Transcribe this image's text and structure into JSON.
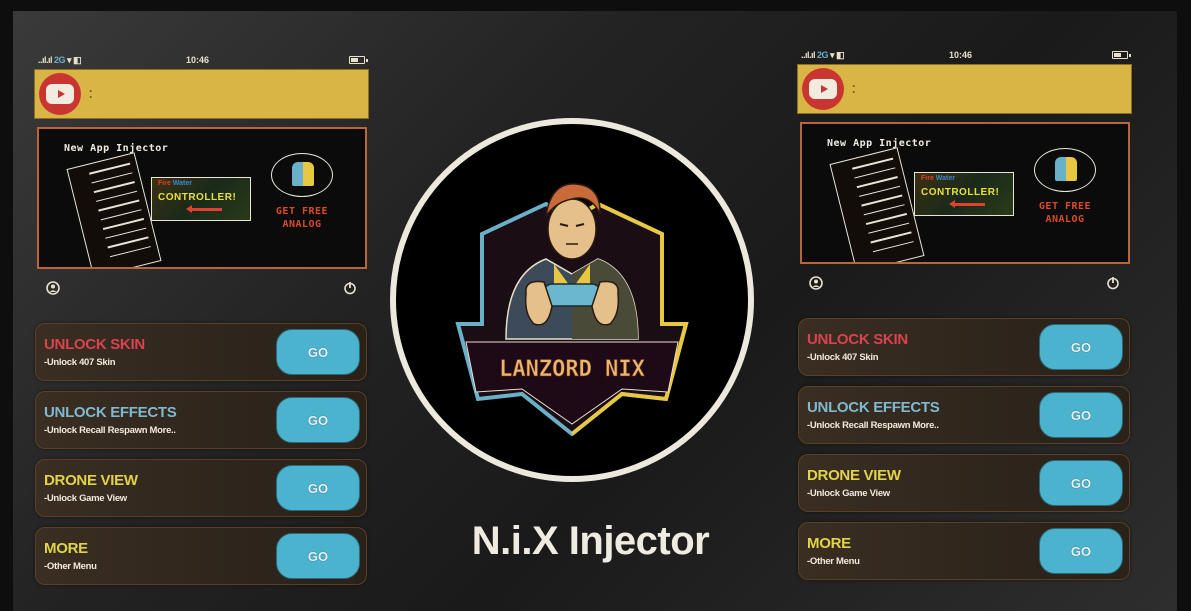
{
  "app": {
    "title": "N.i.X Injector",
    "logo_text": "LANZORD NIX"
  },
  "colors": {
    "appbar": "#d9b545",
    "youtube_red": "#c93632",
    "go_button": "#4cb3cf",
    "card_border": "#5a4026",
    "banner_border": "#b8653a"
  },
  "phones": [
    {
      "status_bar": {
        "signal": "..ıl.ıl",
        "network": "2G",
        "time": "10:46",
        "battery_level": 0.5
      },
      "appbar": {
        "icon": "youtube-icon",
        "menu_icon": "more-vert-icon"
      },
      "banner": {
        "title": "New App Injector",
        "controller_top_left": "Fire",
        "controller_top_right": "Water",
        "controller_label": "CONTROLLER!",
        "promo": "GET FREE ANALOG"
      },
      "icons": {
        "left": "user-icon",
        "right": "power-icon"
      },
      "cards": [
        {
          "title": "UNLOCK SKIN",
          "subtitle": "-Unlock 407 Skin",
          "color": "#d8434f",
          "button": "GO"
        },
        {
          "title": "UNLOCK EFFECTS",
          "subtitle": "-Unlock Recall Respawn More..",
          "color": "#7fb8cf",
          "button": "GO"
        },
        {
          "title": "DRONE VIEW",
          "subtitle": "-Unlock Game View",
          "color": "#e0d34a",
          "button": "GO"
        },
        {
          "title": "MORE",
          "subtitle": "-Other Menu",
          "color": "#e0d34a",
          "button": "GO"
        }
      ]
    },
    {
      "status_bar": {
        "signal": "..ıl.ıl",
        "network": "2G",
        "time": "10:46",
        "battery_level": 0.5
      },
      "appbar": {
        "icon": "youtube-icon",
        "menu_icon": "more-vert-icon"
      },
      "banner": {
        "title": "New App Injector",
        "controller_top_left": "Fire",
        "controller_top_right": "Water",
        "controller_label": "CONTROLLER!",
        "promo": "GET FREE ANALOG"
      },
      "icons": {
        "left": "user-icon",
        "right": "power-icon"
      },
      "cards": [
        {
          "title": "UNLOCK SKIN",
          "subtitle": "-Unlock 407 Skin",
          "color": "#d8434f",
          "button": "GO"
        },
        {
          "title": "UNLOCK EFFECTS",
          "subtitle": "-Unlock Recall Respawn More..",
          "color": "#7fb8cf",
          "button": "GO"
        },
        {
          "title": "DRONE VIEW",
          "subtitle": "-Unlock Game View",
          "color": "#e0d34a",
          "button": "GO"
        },
        {
          "title": "MORE",
          "subtitle": "-Other Menu",
          "color": "#e0d34a",
          "button": "GO"
        }
      ]
    }
  ]
}
